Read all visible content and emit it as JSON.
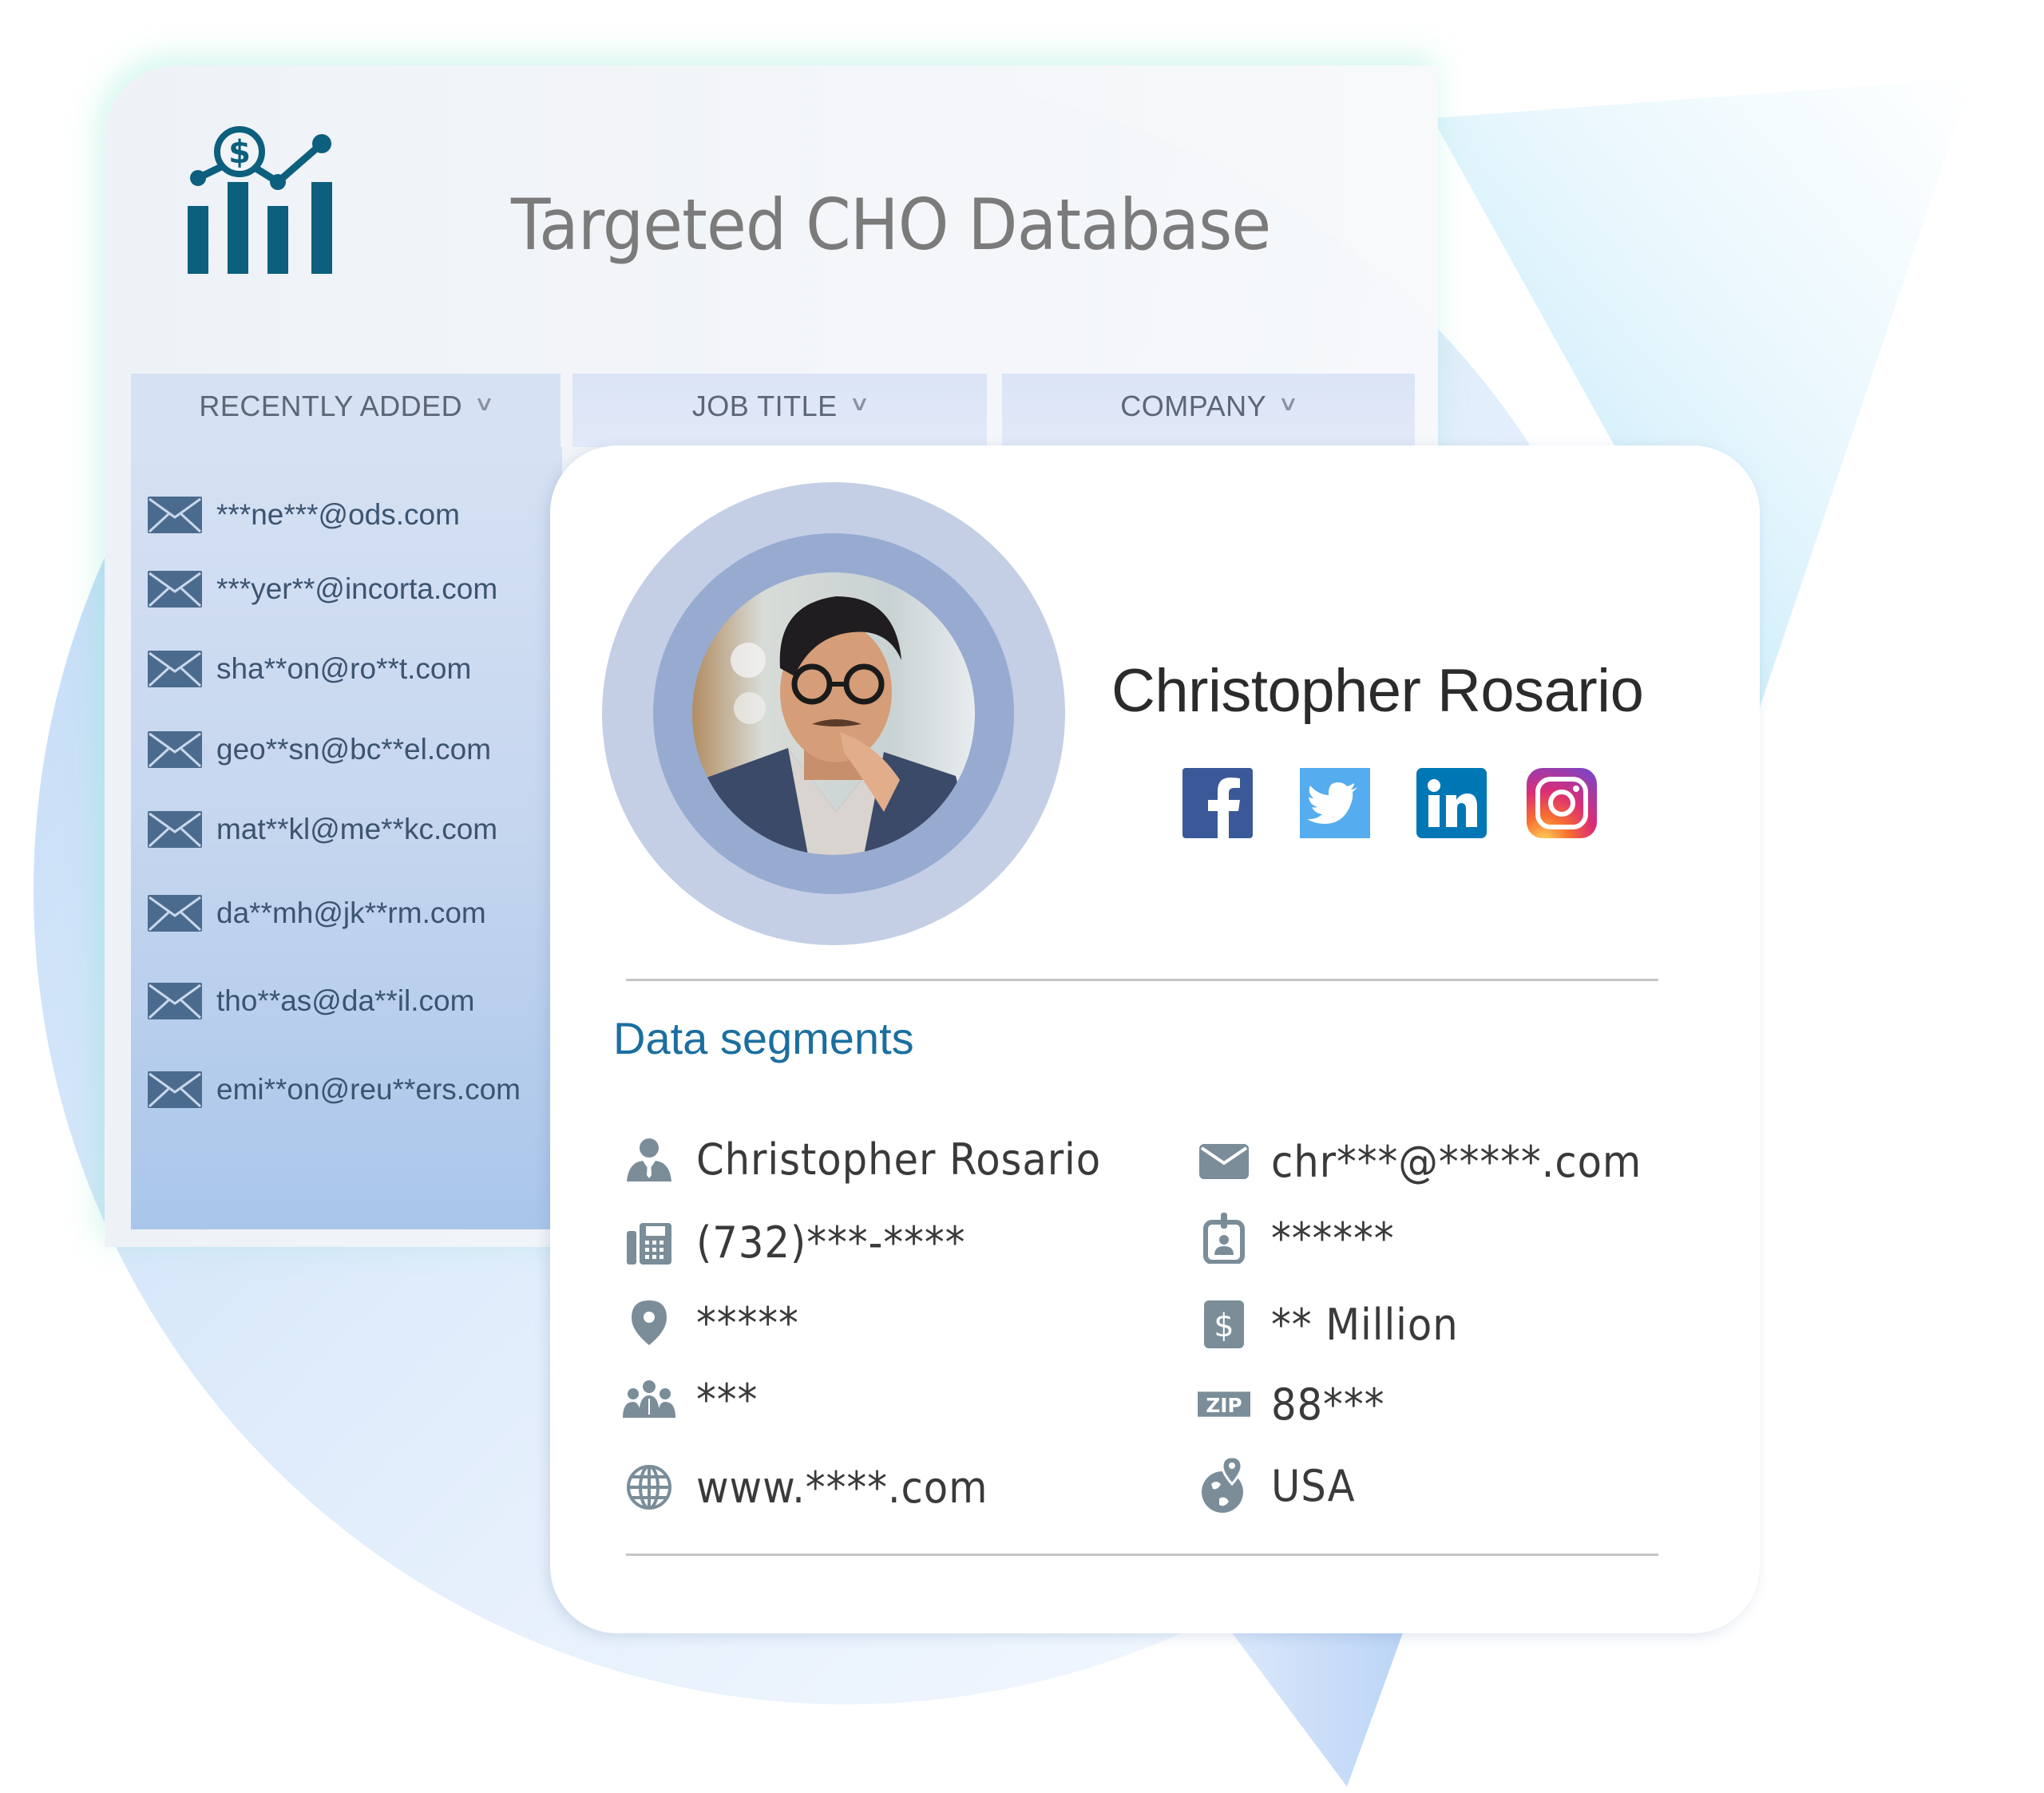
{
  "header": {
    "logo_icon": "dollar-chart-icon",
    "title": "Targeted CHO Database"
  },
  "tabs": [
    {
      "label": "RECENTLY ADDED",
      "icon": "chevron-down-icon"
    },
    {
      "label": "JOB TITLE",
      "icon": "chevron-down-icon"
    },
    {
      "label": "COMPANY",
      "icon": "chevron-down-icon"
    }
  ],
  "recent_emails": [
    "***ne***@ods.com",
    "***yer**@incorta.com",
    "sha**on@ro**t.com",
    "geo**sn@bc**el.com",
    "mat**kl@me**kc.com",
    "da**mh@jk**rm.com",
    "tho**as@da**il.com",
    "emi**on@reu**ers.com"
  ],
  "profile": {
    "name": "Christopher Rosario",
    "avatar": "profile-photo",
    "social": [
      {
        "name": "Facebook",
        "icon": "facebook-icon",
        "color": "#3b5998"
      },
      {
        "name": "Twitter",
        "icon": "twitter-icon",
        "color": "#55acee"
      },
      {
        "name": "LinkedIn",
        "icon": "linkedin-icon",
        "color": "#0077b5"
      },
      {
        "name": "Instagram",
        "icon": "instagram-icon",
        "color": "#c13584"
      }
    ]
  },
  "segments": {
    "title": "Data segments",
    "left": [
      {
        "icon": "person-icon",
        "value": "Christopher Rosario"
      },
      {
        "icon": "phone-fax-icon",
        "value": "(732)***-****"
      },
      {
        "icon": "location-pin-icon",
        "value": "*****"
      },
      {
        "icon": "group-icon",
        "value": "***"
      },
      {
        "icon": "globe-icon",
        "value": "www.****.com"
      }
    ],
    "right": [
      {
        "icon": "envelope-icon",
        "value": "chr***@*****.com"
      },
      {
        "icon": "id-badge-icon",
        "value": "******"
      },
      {
        "icon": "dollar-icon",
        "value": "** Million"
      },
      {
        "icon": "zip-icon",
        "value": "88***",
        "icon_label": "ZIP"
      },
      {
        "icon": "globe-location-icon",
        "value": "USA"
      }
    ]
  },
  "colors": {
    "accent": "#1b6f9f",
    "icon_gray": "#7a8d99",
    "logo": "#0d5f7e",
    "envelope": "#4b6b8e"
  }
}
